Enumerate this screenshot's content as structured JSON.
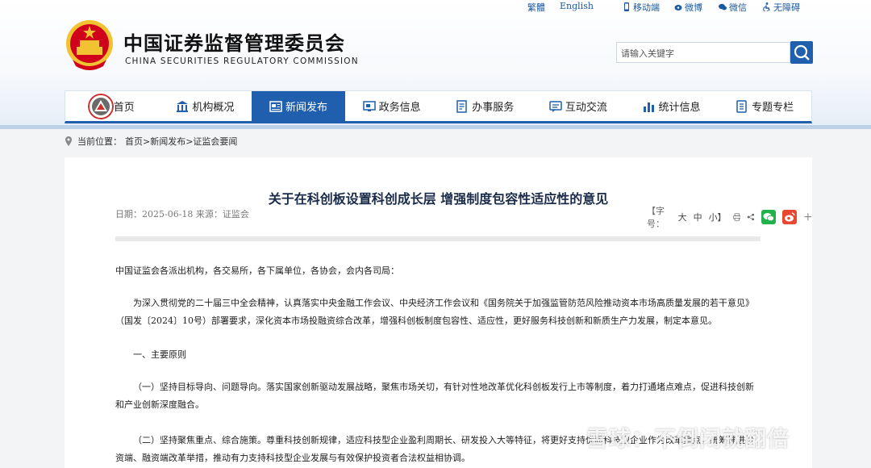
{
  "toplinks": {
    "traditional": "繁體",
    "english": "English",
    "mobile": "移动端",
    "weibo": "微博",
    "wechat": "微信",
    "accessible": "无障碍"
  },
  "header": {
    "title_cn": "中国证券监督管理委员会",
    "title_en": "CHINA SECURITIES REGULATORY COMMISSION",
    "search_placeholder": "请输入关键字"
  },
  "nav": {
    "items": [
      {
        "label": "首页",
        "icon": "home-emblem-icon"
      },
      {
        "label": "机构概况",
        "icon": "building-icon"
      },
      {
        "label": "新闻发布",
        "icon": "news-icon"
      },
      {
        "label": "政务信息",
        "icon": "monitor-icon"
      },
      {
        "label": "办事服务",
        "icon": "document-icon"
      },
      {
        "label": "互动交流",
        "icon": "chat-icon"
      },
      {
        "label": "统计信息",
        "icon": "bar-chart-icon"
      },
      {
        "label": "专题专栏",
        "icon": "notebook-icon"
      }
    ],
    "active_index": 2
  },
  "breadcrumb": {
    "prefix": "当前位置：",
    "path": "首页>新闻发布>证监会要闻"
  },
  "article": {
    "title": "关于在科创板设置科创成长层 增强制度包容性适应性的意见",
    "meta": "日期：2025-06-18 来源：证监会",
    "font_label": "【字号：",
    "size_large": "大",
    "size_medium": "中",
    "size_small": "小】",
    "plus": "+",
    "paragraphs": [
      "中国证监会各派出机构，各交易所，各下属单位，各协会，会内各司局：",
      "为深入贯彻党的二十届三中全会精神，认真落实中央金融工作会议、中央经济工作会议和《国务院关于加强监管防范风险推动资本市场高质量发展的若干意见》（国发〔2024〕10号）部署要求，深化资本市场投融资综合改革，增强科创板制度包容性、适应性，更好服务科技创新和新质生产力发展，制定本意见。",
      "一、主要原则",
      "（一）坚持目标导向、问题导向。落实国家创新驱动发展战略，聚焦市场关切，有针对性地改革优化科创板发行上市等制度，着力打通堵点难点，促进科技创新和产业创新深度融合。",
      "（二）坚持聚焦重点、综合施策。尊重科技创新规律，适应科技型企业盈利周期长、研发投入大等特征，将更好支持优质科技型企业作为改革重点，统筹推进投资端、融资端改革举措，推动有力支持科技型企业发展与有效保护投资者合法权益相协调。"
    ]
  },
  "watermark": "雪球：不倒闭就翻倍",
  "colors": {
    "primary_blue": "#1f5fae",
    "wechat_green": "#22b24c",
    "weibo_red": "#e8482f"
  }
}
